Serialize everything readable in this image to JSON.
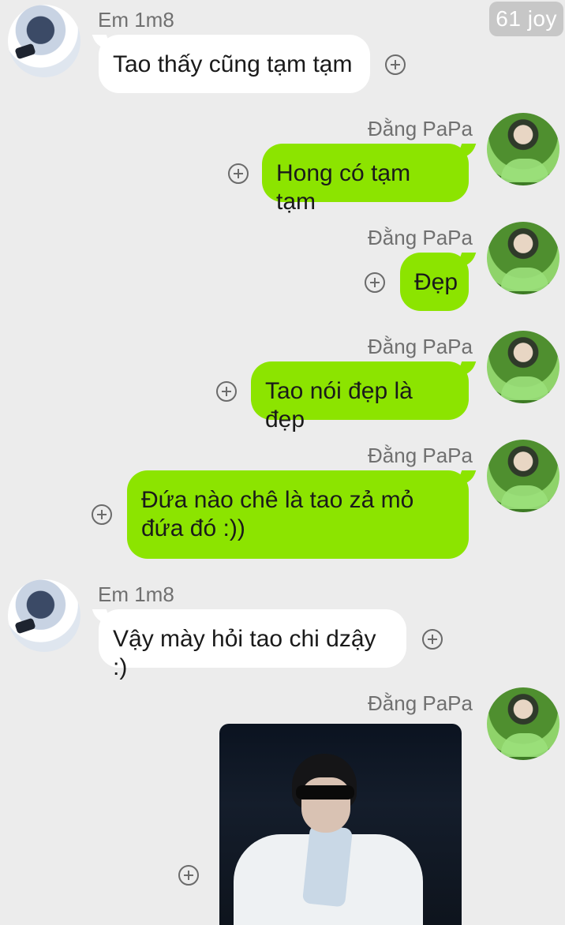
{
  "badge": "61 joy",
  "messages": [
    {
      "sender": "Em 1m8",
      "text": "Tao thấy cũng tạm tạm"
    },
    {
      "sender": "Đằng PaPa",
      "text": "Hong có tạm tạm"
    },
    {
      "sender": "Đằng PaPa",
      "text": "Đẹp"
    },
    {
      "sender": "Đằng PaPa",
      "text": "Tao nói đẹp là đẹp"
    },
    {
      "sender": "Đằng PaPa",
      "text": "Đứa nào chê là tao zả mỏ đứa đó :))"
    },
    {
      "sender": "Em 1m8",
      "text": "Vậy mày hỏi tao chi dzậy :)"
    },
    {
      "sender": "Đằng PaPa",
      "text": ""
    }
  ],
  "icons": {
    "add": "plus-circle-icon"
  },
  "colors": {
    "background": "#ececec",
    "incoming_bubble": "#ffffff",
    "outgoing_bubble": "#8ce400"
  }
}
